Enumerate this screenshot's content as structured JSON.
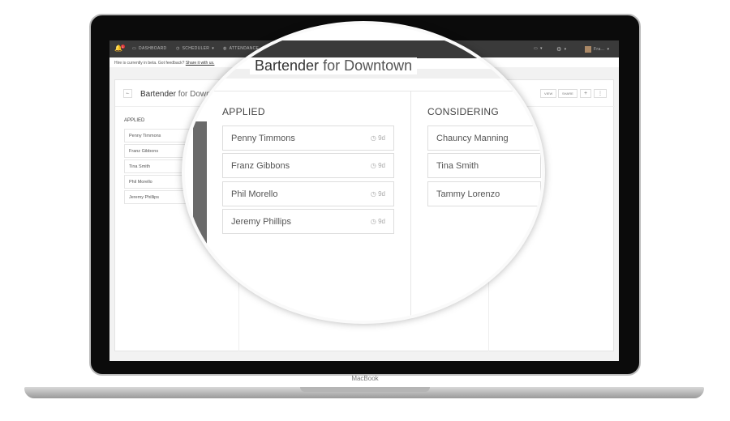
{
  "nav": {
    "notification_count": "1",
    "items": [
      {
        "label": "DASHBOARD",
        "icon": "calendar-icon"
      },
      {
        "label": "SCHEDULER",
        "icon": "clock-icon"
      },
      {
        "label": "ATTENDANCE",
        "icon": "globe-icon"
      }
    ],
    "user": "Fra..."
  },
  "beta": {
    "text": "Hire is currently in beta. Got feedback? ",
    "link": "Share it with us."
  },
  "job": {
    "title_bold": "Bartender",
    "title_rest": " for Downtown",
    "title_rest_truncated": " for Downtc"
  },
  "toolbar": {
    "view": "VIEW",
    "share": "SHARE",
    "add": "+",
    "more": "⋮"
  },
  "background_list": {
    "header": "APPLIED",
    "items": [
      "Penny Timmons",
      "Franz Gibbons",
      "Tina Smith",
      "Phil Morello",
      "Jeremy Phillips"
    ]
  },
  "columns": [
    {
      "header": "APPLIED",
      "items": [
        {
          "name": "Penny Timmons",
          "age": "9d"
        },
        {
          "name": "Franz Gibbons",
          "age": "9d"
        },
        {
          "name": "Phil Morello",
          "age": "9d"
        },
        {
          "name": "Jeremy Phillips",
          "age": "9d"
        }
      ]
    },
    {
      "header": "CONSIDERING",
      "items": [
        {
          "name": "Chauncy Manning"
        },
        {
          "name": "Tina Smith"
        },
        {
          "name": "Tammy Lorenzo"
        }
      ]
    }
  ],
  "device_label": "MacBook"
}
